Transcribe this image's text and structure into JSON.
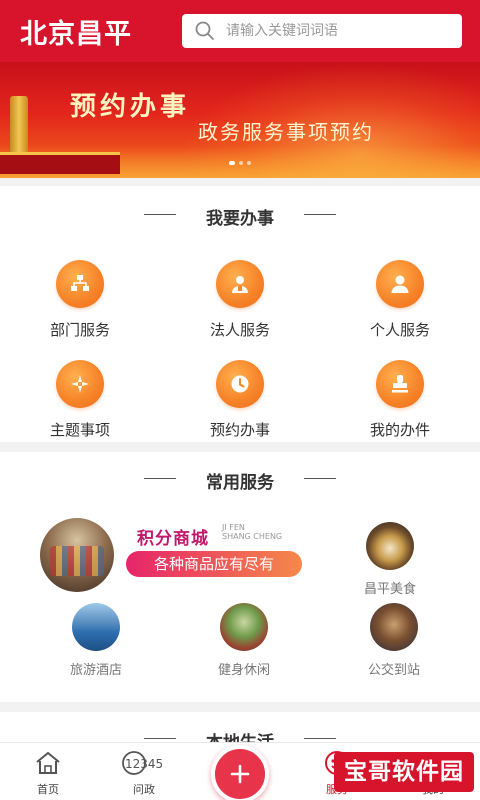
{
  "header": {
    "logo_text": "北京昌平",
    "search_placeholder": "请输入关键词词语",
    "colors": {
      "brand_red": "#d7142b"
    }
  },
  "banner": {
    "title": "预约办事",
    "subtitle": "政务服务事项预约",
    "dots": 3,
    "active_dot": 1
  },
  "section_office": {
    "title": "我要办事",
    "items": [
      {
        "label": "部门服务",
        "icon": "department-icon"
      },
      {
        "label": "法人服务",
        "icon": "legal-person-icon"
      },
      {
        "label": "个人服务",
        "icon": "person-icon"
      },
      {
        "label": "主题事项",
        "icon": "topic-icon"
      },
      {
        "label": "预约办事",
        "icon": "clock-icon"
      },
      {
        "label": "我的办件",
        "icon": "stamp-icon"
      }
    ]
  },
  "section_common": {
    "title": "常用服务",
    "mall": {
      "title": "积分商城",
      "pinyin_line1": "JI FEN",
      "pinyin_line2": "SHANG CHENG",
      "badge": "各种商品应有尽有"
    },
    "items": [
      {
        "label": "昌平美食",
        "icon": "food-photo"
      },
      {
        "label": "旅游酒店",
        "icon": "hotel-photo"
      },
      {
        "label": "健身休闲",
        "icon": "fitness-photo"
      },
      {
        "label": "公交到站",
        "icon": "bus-photo"
      }
    ]
  },
  "section_local": {
    "title": "本地生活"
  },
  "tabbar": {
    "tabs": [
      {
        "label": "首页",
        "icon": "home-icon"
      },
      {
        "label": "问政",
        "icon": "hotline-12345-icon",
        "icon_text": "12345"
      },
      {
        "label": "服务",
        "icon": "service-icon"
      },
      {
        "label": "我的",
        "icon": "user-icon"
      }
    ],
    "fab_icon": "plus-icon"
  },
  "watermark": {
    "text": "宝哥软件园"
  }
}
